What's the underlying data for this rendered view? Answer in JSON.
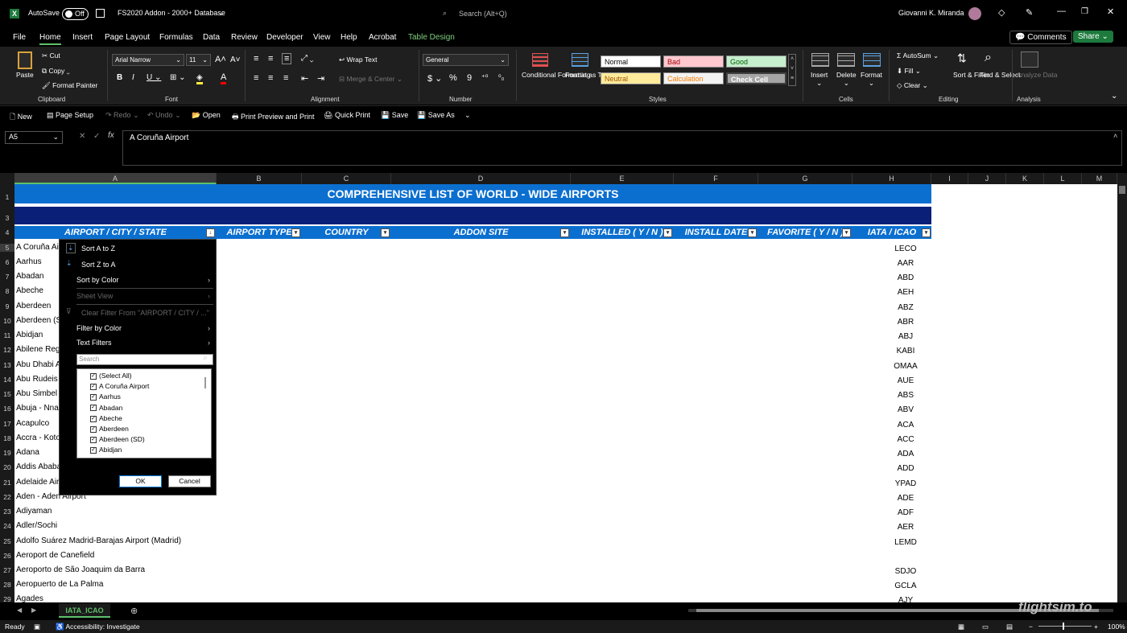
{
  "titlebar": {
    "autosave_label": "AutoSave",
    "autosave_state": "Off",
    "filename": "FS2020 Addon - 2000+ Database",
    "search_placeholder": "Search (Alt+Q)",
    "user": "Giovanni K. Miranda"
  },
  "tabs": [
    "File",
    "Home",
    "Insert",
    "Page Layout",
    "Formulas",
    "Data",
    "Review",
    "Developer",
    "View",
    "Help",
    "Acrobat",
    "Table Design"
  ],
  "tab_buttons": {
    "comments": "Comments",
    "share": "Share"
  },
  "ribbon": {
    "clipboard": {
      "label": "Clipboard",
      "paste": "Paste",
      "cut": "Cut",
      "copy": "Copy",
      "format_painter": "Format Painter"
    },
    "font": {
      "label": "Font",
      "name": "Arial Narrow",
      "size": "11"
    },
    "alignment": {
      "label": "Alignment",
      "wrap": "Wrap Text",
      "merge": "Merge & Center"
    },
    "number": {
      "label": "Number",
      "format": "General"
    },
    "styles": {
      "label": "Styles",
      "conditional": "Conditional Formatting",
      "format_table": "Format as Table",
      "normal": "Normal",
      "bad": "Bad",
      "good": "Good",
      "neutral": "Neutral",
      "calculation": "Calculation",
      "check": "Check Cell"
    },
    "cells": {
      "label": "Cells",
      "insert": "Insert",
      "delete": "Delete",
      "format": "Format"
    },
    "editing": {
      "label": "Editing",
      "autosum": "AutoSum",
      "fill": "Fill",
      "clear": "Clear",
      "sort": "Sort & Filter",
      "find": "Find & Select"
    },
    "analysis": {
      "label": "Analysis",
      "analyze": "Analyze Data"
    }
  },
  "qat": {
    "new": "New",
    "page_setup": "Page Setup",
    "redo": "Redo",
    "undo": "Undo",
    "open": "Open",
    "print_preview": "Print Preview and Print",
    "quick_print": "Quick Print",
    "save": "Save",
    "save_as": "Save As"
  },
  "formula_bar": {
    "name_box": "A5",
    "fx": "fx",
    "content": "A Coruña Airport"
  },
  "columns": [
    "A",
    "B",
    "C",
    "D",
    "E",
    "F",
    "G",
    "H",
    "I",
    "J",
    "K",
    "L",
    "M"
  ],
  "rows": [
    "1",
    "3",
    "4",
    "5",
    "6",
    "7",
    "8",
    "9",
    "10",
    "11",
    "12",
    "13",
    "14",
    "15",
    "16",
    "17",
    "18",
    "19",
    "20",
    "21",
    "22",
    "23",
    "24",
    "25",
    "26",
    "27",
    "28",
    "29"
  ],
  "sheet": {
    "title": "COMPREHENSIVE LIST OF WORLD - WIDE AIRPORTS",
    "headers": [
      "AIRPORT / CITY / STATE",
      "AIRPORT TYPE",
      "COUNTRY",
      "ADDON SITE",
      "INSTALLED  ( Y / N )",
      "INSTALL DATE",
      "FAVORITE ( Y / N )",
      "IATA / ICAO"
    ],
    "airports": [
      "A Coruña Airp",
      "Aarhus",
      "Abadan",
      "Abeche",
      "Aberdeen",
      "Aberdeen (SD",
      "Abidjan",
      "Abilene Regi",
      "Abu Dhabi Ai",
      "Abu Rudeis",
      "Abu Simbel",
      "Abuja - Nnam",
      "Acapulco",
      "Accra - Kotok",
      "Adana",
      "Addis Ababa",
      "Adelaide Airp",
      "Aden - Aden Airport",
      "Adiyaman",
      "Adler/Sochi",
      "Adolfo Suárez Madrid-Barajas Airport (Madrid)",
      "Aeroport de Canefield",
      "Aeroporto de São Joaquim da Barra",
      "Aeropuerto de La Palma",
      "Agades"
    ],
    "codes": [
      "LECO",
      "AAR",
      "ABD",
      "AEH",
      "ABZ",
      "ABR",
      "ABJ",
      "KABI",
      "OMAA",
      "AUE",
      "ABS",
      "ABV",
      "ACA",
      "ACC",
      "ADA",
      "ADD",
      "YPAD",
      "ADE",
      "ADF",
      "AER",
      "LEMD",
      "",
      "SDJO",
      "GCLA",
      "AJY"
    ]
  },
  "filter_menu": {
    "sort_az": "Sort A to Z",
    "sort_za": "Sort Z to A",
    "sort_color": "Sort by Color",
    "sheet_view": "Sheet View",
    "clear_filter": "Clear Filter From \"AIRPORT / CITY / ...\"",
    "filter_color": "Filter by Color",
    "text_filters": "Text Filters",
    "search_placeholder": "Search",
    "items": [
      "(Select All)",
      "A Coruña Airport",
      "Aarhus",
      "Abadan",
      "Abeche",
      "Aberdeen",
      "Aberdeen (SD)",
      "Abidjan"
    ],
    "ok": "OK",
    "cancel": "Cancel"
  },
  "sheet_tab": "IATA_ICAO",
  "status": {
    "ready": "Ready",
    "accessibility": "Accessibility: Investigate",
    "zoom": "100%"
  },
  "watermark": "flightsim.to",
  "colors": {
    "banner": "#0b6fcf",
    "banner2": "#0a1f78",
    "accent": "#1d7a3d"
  }
}
